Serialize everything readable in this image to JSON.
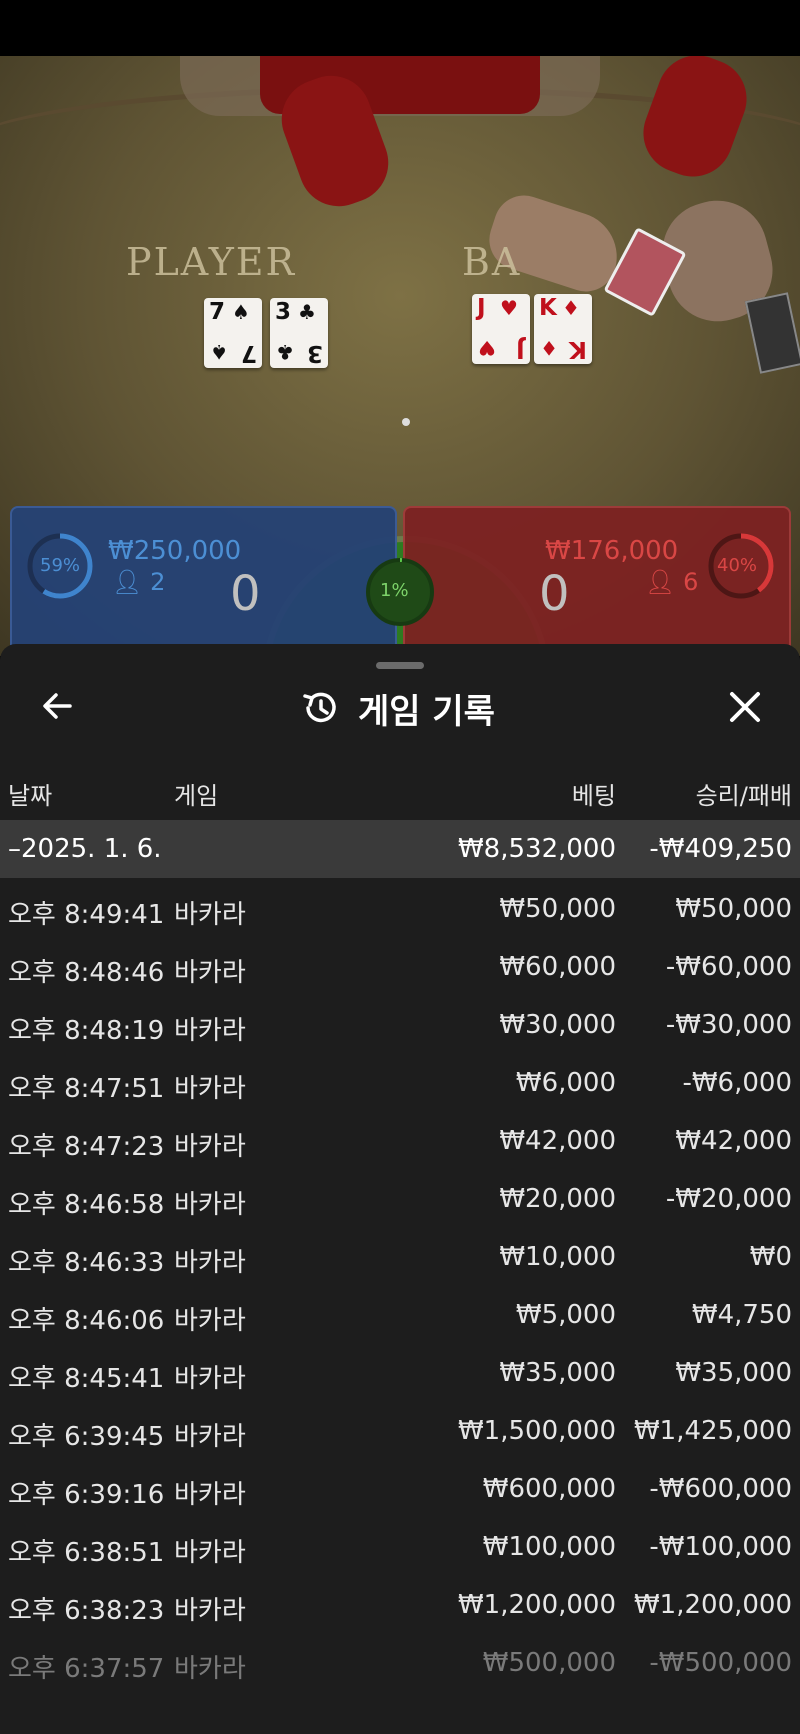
{
  "video": {
    "player_label": "PLAYER",
    "banker_label": "BA",
    "player_cards": [
      {
        "rank": "7",
        "suit": "♠",
        "color": "black"
      },
      {
        "rank": "3",
        "suit": "♣",
        "color": "black"
      }
    ],
    "banker_cards": [
      {
        "rank": "J",
        "suit": "♥",
        "color": "red"
      },
      {
        "rank": "K",
        "suit": "♦",
        "color": "red"
      }
    ]
  },
  "bet_stats": {
    "player": {
      "percent": 59,
      "percent_text": "59%",
      "amount": "₩250,000",
      "players": "2",
      "score": "0",
      "color": "#3f88d6"
    },
    "banker": {
      "percent": 40,
      "percent_text": "40%",
      "amount": "₩176,000",
      "players": "6",
      "score": "0",
      "color": "#e0383a"
    },
    "tie": {
      "percent": 1,
      "percent_text": "1%",
      "color": "#5ccb4a"
    }
  },
  "sheet": {
    "title": "게임 기록",
    "icons": {
      "back": "arrow-left-icon",
      "history": "history-icon",
      "close": "close-icon"
    },
    "headers": {
      "date": "날짜",
      "game": "게임",
      "bet": "베팅",
      "result": "승리/패배"
    },
    "summary": {
      "date": "–2025. 1. 6.",
      "bet": "₩8,532,000",
      "result": "-₩409,250"
    },
    "rows": [
      {
        "time": "오후 8:49:41",
        "game": "바카라",
        "bet": "₩50,000",
        "result": "₩50,000"
      },
      {
        "time": "오후 8:48:46",
        "game": "바카라",
        "bet": "₩60,000",
        "result": "-₩60,000"
      },
      {
        "time": "오후 8:48:19",
        "game": "바카라",
        "bet": "₩30,000",
        "result": "-₩30,000"
      },
      {
        "time": "오후 8:47:51",
        "game": "바카라",
        "bet": "₩6,000",
        "result": "-₩6,000"
      },
      {
        "time": "오후 8:47:23",
        "game": "바카라",
        "bet": "₩42,000",
        "result": "₩42,000"
      },
      {
        "time": "오후 8:46:58",
        "game": "바카라",
        "bet": "₩20,000",
        "result": "-₩20,000"
      },
      {
        "time": "오후 8:46:33",
        "game": "바카라",
        "bet": "₩10,000",
        "result": "₩0"
      },
      {
        "time": "오후 8:46:06",
        "game": "바카라",
        "bet": "₩5,000",
        "result": "₩4,750"
      },
      {
        "time": "오후 8:45:41",
        "game": "바카라",
        "bet": "₩35,000",
        "result": "₩35,000"
      },
      {
        "time": "오후 6:39:45",
        "game": "바카라",
        "bet": "₩1,500,000",
        "result": "₩1,425,000"
      },
      {
        "time": "오후 6:39:16",
        "game": "바카라",
        "bet": "₩600,000",
        "result": "-₩600,000"
      },
      {
        "time": "오후 6:38:51",
        "game": "바카라",
        "bet": "₩100,000",
        "result": "-₩100,000"
      },
      {
        "time": "오후 6:38:23",
        "game": "바카라",
        "bet": "₩1,200,000",
        "result": "₩1,200,000"
      },
      {
        "time": "오후 6:37:57",
        "game": "바카라",
        "bet": "₩500,000",
        "result": "-₩500,000"
      }
    ]
  }
}
